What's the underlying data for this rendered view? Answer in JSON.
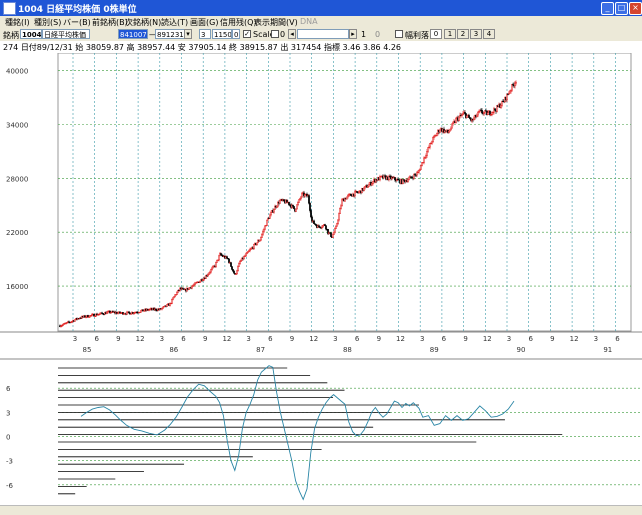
{
  "window": {
    "title": "1004 日経平均株価 0株単位"
  },
  "menu": [
    {
      "label": "種銘(I)",
      "x": 5
    },
    {
      "label": "種別(S)",
      "x": 34
    },
    {
      "label": "バー(B)",
      "x": 63
    },
    {
      "label": "前銘柄(B)",
      "x": 92
    },
    {
      "label": "次銘柄(N)",
      "x": 125
    },
    {
      "label": "読込(T)",
      "x": 161
    },
    {
      "label": "画面(G)",
      "x": 190
    },
    {
      "label": "信用残(Q)",
      "x": 220
    },
    {
      "label": "表示期間(V)",
      "x": 254
    },
    {
      "label": "DNA",
      "x": 300,
      "disabled": true
    }
  ],
  "toolbar": {
    "code_label": "銘柄",
    "code": "1004",
    "name": "日経平均株価",
    "start_date": "841007",
    "dash": "—",
    "end_date": "891231",
    "field3": "3",
    "field1150": "1150",
    "field0": "0",
    "scale_label": "Scale",
    "scale_value": "0",
    "num1": "1",
    "num0": "0",
    "width_label": "幅利落",
    "buttons": [
      "0",
      "1",
      "2",
      "3",
      "4"
    ]
  },
  "info_text": "274 日付89/12/31 始 38059.87 高 38957.44 安 37905.14 終 38915.87 出 317454 指標 3.46  3.86  4.26",
  "chart_data": [
    {
      "type": "candlestick",
      "panel": "price",
      "y_ticks": [
        16000,
        22000,
        28000,
        34000,
        40000
      ],
      "y_tick_labels": [
        "16000",
        "22000",
        "28000",
        "34000",
        "40000"
      ],
      "ylim": [
        11000,
        41500
      ],
      "x_month_labels": [
        "3",
        "6",
        "9",
        "12",
        "3",
        "6",
        "9",
        "12",
        "3",
        "6",
        "9",
        "12",
        "3",
        "6",
        "9",
        "12",
        "3",
        "6",
        "9",
        "12",
        "3",
        "6",
        "9",
        "12",
        "3",
        "6",
        "9",
        "12",
        "3"
      ],
      "x_year_labels": [
        "85",
        "86",
        "87",
        "88",
        "89",
        "90",
        "91"
      ],
      "close_path": [
        [
          0,
          11600
        ],
        [
          10,
          12000
        ],
        [
          20,
          12500
        ],
        [
          30,
          12700
        ],
        [
          40,
          12900
        ],
        [
          50,
          13100
        ],
        [
          60,
          13000
        ],
        [
          70,
          13000
        ],
        [
          80,
          13200
        ],
        [
          90,
          13400
        ],
        [
          100,
          13400
        ],
        [
          110,
          14000
        ],
        [
          115,
          15000
        ],
        [
          120,
          15700
        ],
        [
          125,
          15500
        ],
        [
          135,
          16200
        ],
        [
          145,
          17000
        ],
        [
          155,
          18300
        ],
        [
          160,
          19500
        ],
        [
          168,
          19000
        ],
        [
          175,
          17200
        ],
        [
          180,
          18700
        ],
        [
          190,
          20000
        ],
        [
          200,
          21200
        ],
        [
          208,
          23500
        ],
        [
          215,
          24800
        ],
        [
          220,
          25500
        ],
        [
          228,
          25300
        ],
        [
          235,
          24500
        ],
        [
          242,
          26200
        ],
        [
          248,
          26000
        ],
        [
          252,
          23200
        ],
        [
          258,
          22600
        ],
        [
          265,
          22800
        ],
        [
          268,
          22000
        ],
        [
          272,
          21500
        ],
        [
          276,
          22500
        ],
        [
          282,
          25500
        ],
        [
          288,
          26000
        ],
        [
          295,
          26300
        ],
        [
          300,
          26500
        ],
        [
          308,
          27200
        ],
        [
          315,
          27800
        ],
        [
          322,
          28100
        ],
        [
          332,
          28000
        ],
        [
          342,
          27600
        ],
        [
          350,
          28000
        ],
        [
          358,
          28600
        ],
        [
          365,
          30500
        ],
        [
          372,
          32200
        ],
        [
          380,
          33500
        ],
        [
          388,
          33100
        ],
        [
          396,
          34500
        ],
        [
          404,
          35200
        ],
        [
          412,
          34400
        ],
        [
          420,
          35400
        ],
        [
          428,
          35200
        ],
        [
          436,
          35700
        ],
        [
          444,
          36600
        ],
        [
          450,
          37800
        ],
        [
          456,
          38900
        ]
      ]
    },
    {
      "type": "line",
      "panel": "indicator",
      "y_ticks": [
        6,
        3,
        0,
        -3,
        -6
      ],
      "y_tick_labels": [
        "6",
        "3",
        "0",
        "-3",
        "-6"
      ],
      "ylim": [
        -8.5,
        9.5
      ],
      "x_range": [
        0,
        456
      ],
      "series": [
        {
          "values": [
            [
              0,
              2.5
            ],
            [
              6,
              3.0
            ],
            [
              12,
              3.4
            ],
            [
              18,
              3.6
            ],
            [
              24,
              3.7
            ],
            [
              30,
              3.3
            ],
            [
              36,
              2.7
            ],
            [
              42,
              2.0
            ],
            [
              48,
              1.4
            ],
            [
              56,
              0.9
            ],
            [
              64,
              0.7
            ],
            [
              72,
              0.4
            ],
            [
              80,
              0.2
            ],
            [
              88,
              0.8
            ],
            [
              94,
              1.5
            ],
            [
              100,
              2.4
            ],
            [
              106,
              3.6
            ],
            [
              112,
              4.9
            ],
            [
              118,
              5.8
            ],
            [
              124,
              6.5
            ],
            [
              130,
              6.3
            ],
            [
              136,
              5.6
            ],
            [
              142,
              5.0
            ],
            [
              146,
              4.2
            ],
            [
              150,
              2.6
            ],
            [
              154,
              -0.5
            ],
            [
              158,
              -3.0
            ],
            [
              162,
              -4.2
            ],
            [
              166,
              -2.4
            ],
            [
              170,
              1.0
            ],
            [
              174,
              3.0
            ],
            [
              178,
              4.0
            ],
            [
              182,
              5.2
            ],
            [
              186,
              7.0
            ],
            [
              190,
              8.0
            ],
            [
              194,
              8.4
            ],
            [
              198,
              8.8
            ],
            [
              202,
              8.6
            ],
            [
              206,
              5.5
            ],
            [
              210,
              3.0
            ],
            [
              214,
              1.0
            ],
            [
              218,
              -1.0
            ],
            [
              222,
              -3.0
            ],
            [
              226,
              -5.5
            ],
            [
              230,
              -6.8
            ],
            [
              234,
              -7.8
            ],
            [
              238,
              -6.5
            ],
            [
              242,
              -2.0
            ],
            [
              246,
              1.0
            ],
            [
              250,
              2.4
            ],
            [
              254,
              3.4
            ],
            [
              258,
              4.2
            ],
            [
              262,
              4.8
            ],
            [
              266,
              5.2
            ],
            [
              270,
              4.8
            ],
            [
              274,
              4.4
            ],
            [
              278,
              4.0
            ],
            [
              282,
              1.8
            ],
            [
              286,
              0.6
            ],
            [
              290,
              0.1
            ],
            [
              294,
              0.2
            ],
            [
              298,
              0.8
            ],
            [
              302,
              1.8
            ],
            [
              306,
              3.0
            ],
            [
              310,
              3.6
            ],
            [
              314,
              2.9
            ],
            [
              318,
              2.4
            ],
            [
              322,
              2.8
            ],
            [
              326,
              3.6
            ],
            [
              330,
              4.4
            ],
            [
              334,
              4.2
            ],
            [
              338,
              3.6
            ],
            [
              342,
              4.1
            ],
            [
              346,
              3.8
            ],
            [
              350,
              4.2
            ],
            [
              356,
              3.5
            ],
            [
              360,
              2.4
            ],
            [
              366,
              2.6
            ],
            [
              372,
              1.4
            ],
            [
              378,
              1.6
            ],
            [
              384,
              2.6
            ],
            [
              390,
              2.0
            ],
            [
              396,
              2.6
            ],
            [
              402,
              2.0
            ],
            [
              408,
              2.2
            ],
            [
              414,
              3.0
            ],
            [
              420,
              3.8
            ],
            [
              426,
              3.2
            ],
            [
              432,
              2.4
            ],
            [
              438,
              2.5
            ],
            [
              444,
              2.8
            ],
            [
              450,
              3.4
            ],
            [
              456,
              4.4
            ]
          ]
        }
      ],
      "volume_profile": [
        [
          0.4,
          0.0
        ],
        [
          0.44,
          0.0
        ],
        [
          0.47,
          0.0
        ],
        [
          0.5,
          0.0
        ],
        [
          0.48,
          0.0
        ],
        [
          0.63,
          0.0
        ],
        [
          0.58,
          0.0
        ],
        [
          0.78,
          0.0
        ],
        [
          0.55,
          0.0
        ],
        [
          0.88,
          0.0
        ],
        [
          0.73,
          0.0
        ],
        [
          0.46,
          0.0
        ],
        [
          0.34,
          0.0
        ],
        [
          0.22,
          0.0
        ],
        [
          0.15,
          0.0
        ],
        [
          0.1,
          0.0
        ],
        [
          0.05,
          0.0
        ],
        [
          0.03,
          0.0
        ]
      ]
    }
  ]
}
